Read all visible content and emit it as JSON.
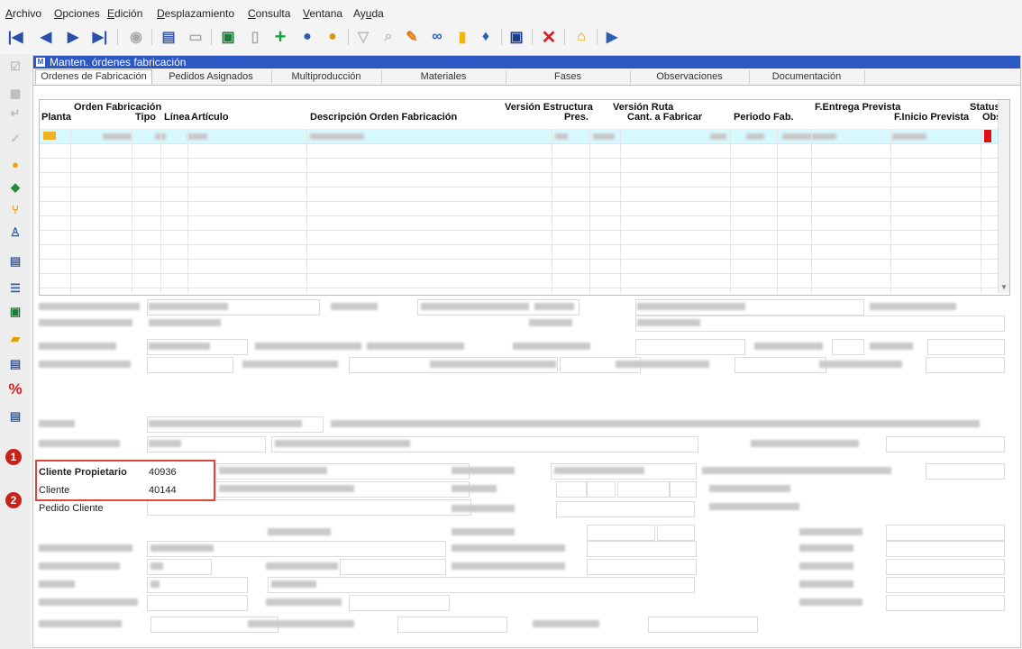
{
  "menu": [
    "Archivo",
    "Opciones",
    "Edición",
    "Desplazamiento",
    "Consulta",
    "Ventana",
    "Ayuda"
  ],
  "menu_underline": [
    "A",
    "O",
    "E",
    "D",
    "C",
    "V",
    "u"
  ],
  "window": {
    "title": "Manten. órdenes fabricación"
  },
  "tabs": [
    "Ordenes de Fabricación",
    "Pedidos Asignados",
    "Multiproducción",
    "Materiales",
    "Fases",
    "Observaciones",
    "Documentación"
  ],
  "active_tab": 0,
  "grid": {
    "headers": {
      "orden_fabricacion": "Orden Fabricación",
      "planta": "Planta",
      "tipo": "Tipo",
      "linea": "Línea",
      "articulo": "Artículo",
      "descripcion": "Descripción Orden Fabricación",
      "version_estructura": "Versión Estructura",
      "pres": "Pres.",
      "version_ruta": "Versión Ruta",
      "cant_fabricar": "Cant. a Fabricar",
      "periodo_fab": "Periodo Fab.",
      "f_entrega": "F.Entrega Prevista",
      "f_inicio": "F.Inicio Prevista",
      "status": "Status",
      "obs": "Obs"
    },
    "empty_rows": 11,
    "status_color": "#e01010"
  },
  "fields": {
    "cliente_propietario": {
      "label": "Cliente Propietario",
      "value": "40936"
    },
    "cliente": {
      "label": "Cliente",
      "value": "40144"
    },
    "pedido_cliente": {
      "label": "Pedido Cliente",
      "value": ""
    }
  },
  "badges": [
    "1",
    "2"
  ],
  "colors": {
    "accent": "#2d57c2",
    "highlight": "#e0463a",
    "badge": "#c8231b",
    "selected_row": "#d8f8ff"
  }
}
